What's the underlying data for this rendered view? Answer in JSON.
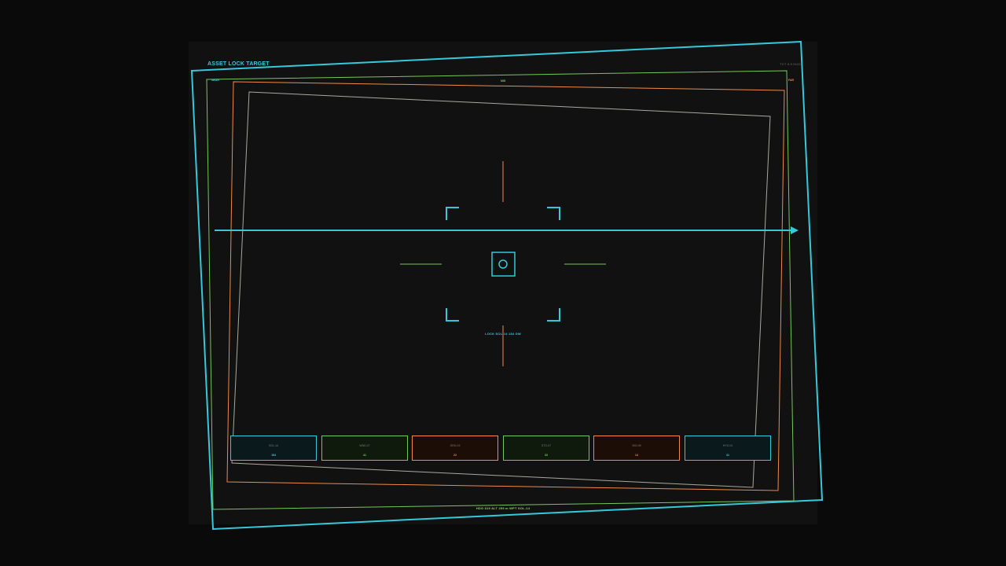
{
  "header": {
    "title": "ASSET LOCK TARGET",
    "top_right": "TGT 8.5 HUD"
  },
  "band_labels": {
    "left": "NEAR",
    "middle": "MID",
    "right": "FAR"
  },
  "reticle": {
    "lock_text": "LOCK SOL-14 184 GW"
  },
  "footer": {
    "status": "HDG 819  ALT 259 m  WPT SOL-14"
  },
  "asset_cards": [
    {
      "name": "SOL-14",
      "value": "184",
      "accent": "#35c9dc"
    },
    {
      "name": "WND-07",
      "value": "41",
      "accent": "#76c85a"
    },
    {
      "name": "GRD-03",
      "value": "22",
      "accent": "#ef8a4b"
    },
    {
      "name": "STO-07",
      "value": "33",
      "accent": "#76c85a"
    },
    {
      "name": "BIO-05",
      "value": "14",
      "accent": "#ef8a4b"
    },
    {
      "name": "HYD-01",
      "value": "31",
      "accent": "#35c9dc"
    }
  ],
  "colors": {
    "cyan": "#35c9dc",
    "green": "#76c85a",
    "orange": "#ef8a4b",
    "gray": "#a8a8a0",
    "background": "#111111"
  }
}
